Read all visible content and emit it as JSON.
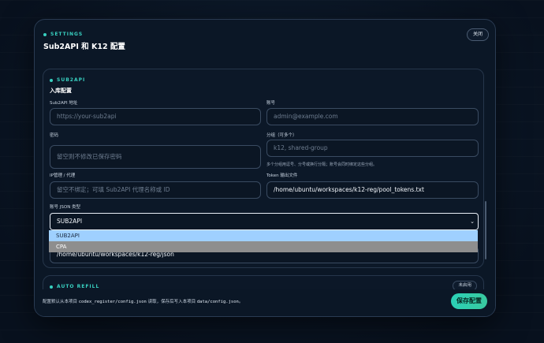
{
  "header": {
    "eyebrow": "SETTINGS",
    "title": "Sub2API 和 K12 配置",
    "close_label": "关闭"
  },
  "sub2api": {
    "eyebrow": "SUB2API",
    "title": "入库配置",
    "url_label": "Sub2API 地址",
    "url_placeholder": "https://your-sub2api",
    "account_label": "账号",
    "account_placeholder": "admin@example.com",
    "password_label": "密码",
    "password_placeholder": "留空则不修改已保存密码",
    "group_label": "分组（可多个）",
    "group_placeholder": "k12, shared-group",
    "group_hint": "多个分组用逗号、分号或换行分隔；账号会同时绑定这些分组。",
    "proxy_label": "IP管理 / 代理",
    "proxy_placeholder": "留空不绑定；可填 Sub2API 代理名称或 ID",
    "token_label": "Token 输出文件",
    "token_value": "/home/ubuntu/workspaces/k12-reg/pool_tokens.txt",
    "json_type_label": "账号 JSON 类型",
    "json_type_value": "SUB2API",
    "json_type_options": [
      "SUB2API",
      "CPA"
    ],
    "json_dir_value": "/home/ubuntu/workspaces/k12-reg/json"
  },
  "auto_refill": {
    "eyebrow": "AUTO REFILL",
    "status_label": "未启用"
  },
  "footer": {
    "note_prefix": "配置默认从本项目 ",
    "note_path1": "codex_register/config.json",
    "note_mid": " 读取，保存后写入本项目 ",
    "note_path2": "data/config.json",
    "note_suffix": "。",
    "save_label": "保存配置"
  },
  "colors": {
    "accent": "#38d0c0",
    "save_button": "#2bd1b6",
    "selected_option": "#9fd0ff",
    "other_option": "#8e8e8e"
  }
}
